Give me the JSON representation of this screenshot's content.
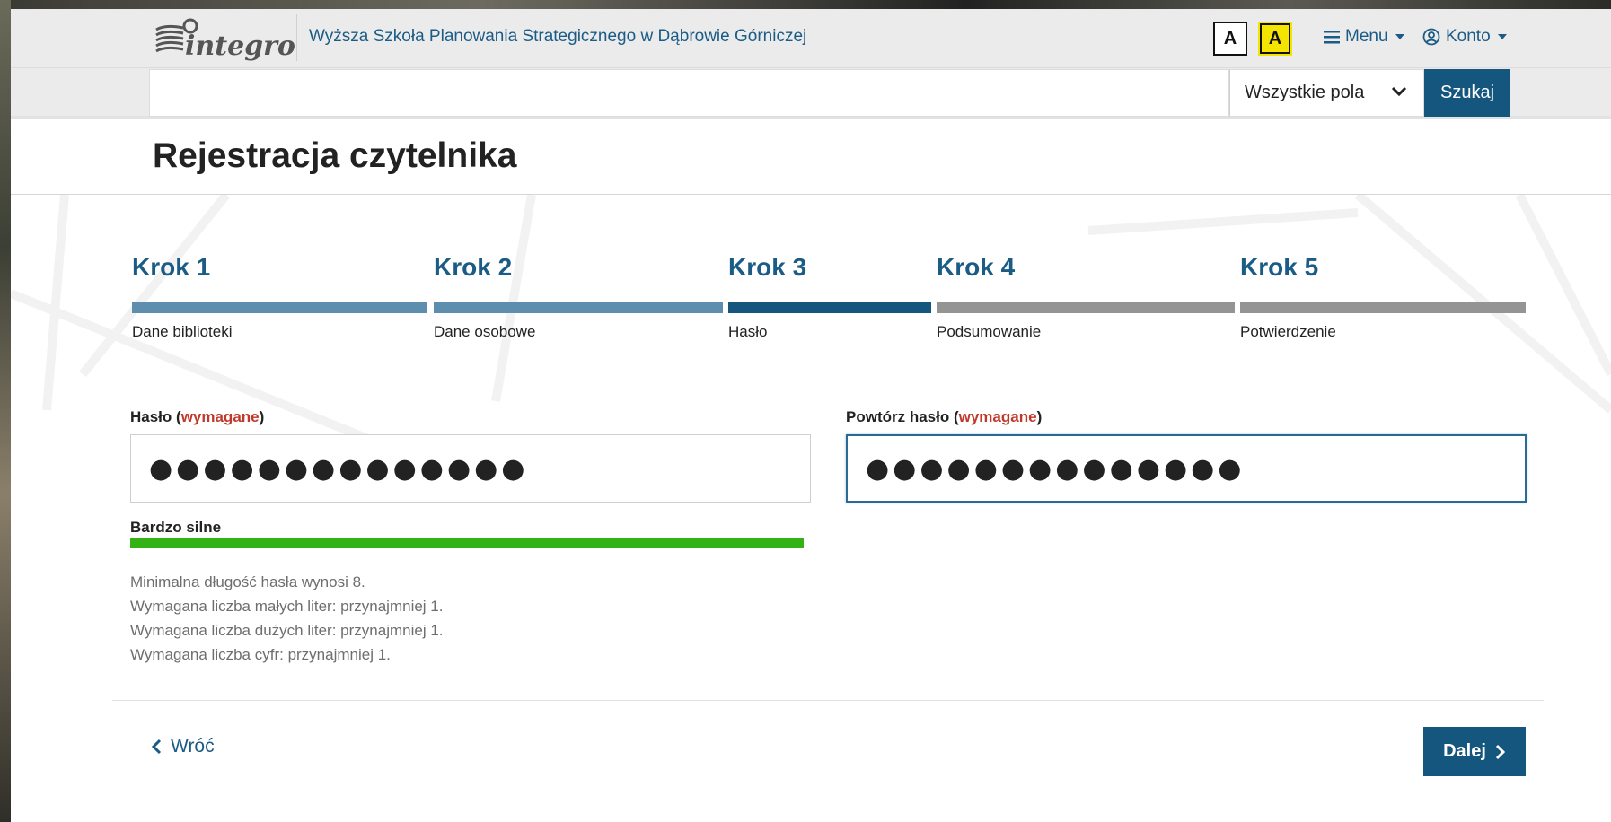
{
  "header": {
    "logo_text": "integro",
    "institution": "Wyższa Szkoła Planowania Strategicznego w Dąbrowie Górniczej",
    "contrast_normal_label": "A",
    "contrast_high_label": "A",
    "menu_label": "Menu",
    "account_label": "Konto"
  },
  "search": {
    "value": "",
    "placeholder": "",
    "field_select": "Wszystkie pola",
    "button_label": "Szukaj"
  },
  "page": {
    "title": "Rejestracja czytelnika"
  },
  "steps": [
    {
      "title": "Krok 1",
      "subtitle": "Dane biblioteki",
      "state": "done",
      "color": "#5e8ead"
    },
    {
      "title": "Krok 2",
      "subtitle": "Dane osobowe",
      "state": "done",
      "color": "#5e8ead"
    },
    {
      "title": "Krok 3",
      "subtitle": "Hasło",
      "state": "active",
      "color": "#15567f"
    },
    {
      "title": "Krok 4",
      "subtitle": "Podsumowanie",
      "state": "pending",
      "color": "#949494"
    },
    {
      "title": "Krok 5",
      "subtitle": "Potwierdzenie",
      "state": "pending",
      "color": "#949494"
    }
  ],
  "form": {
    "password": {
      "label": "Hasło",
      "required_text": "wymagane",
      "value_masked": "●●●●●●●●●●●●●●"
    },
    "repeat_password": {
      "label": "Powtórz hasło",
      "required_text": "wymagane",
      "value_masked": "●●●●●●●●●●●●●●"
    },
    "strength": {
      "label": "Bardzo silne",
      "fraction": 1.0,
      "color": "#33b213"
    },
    "rules": [
      "Minimalna długość hasła wynosi 8.",
      "Wymagana liczba małych liter: przynajmniej 1.",
      "Wymagana liczba dużych liter: przynajmniej 1.",
      "Wymagana liczba cyfr: przynajmniej 1."
    ]
  },
  "nav": {
    "back_label": "Wróć",
    "next_label": "Dalej"
  },
  "colors": {
    "primary": "#15567f",
    "link": "#1b5c86",
    "required": "#c0392b",
    "strength": "#33b213"
  }
}
